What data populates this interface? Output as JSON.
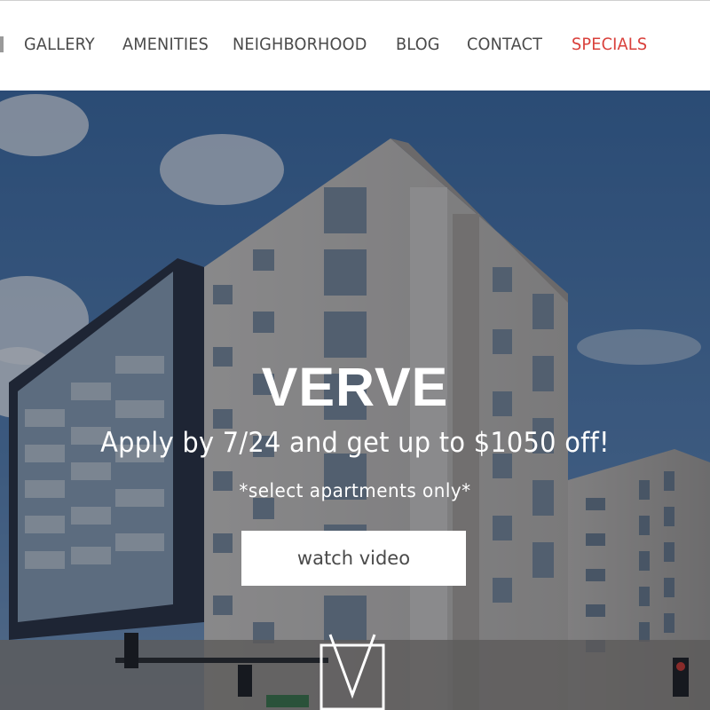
{
  "nav": {
    "items": [
      {
        "label": "GALLERY"
      },
      {
        "label": "AMENITIES"
      },
      {
        "label": "NEIGHBORHOOD"
      },
      {
        "label": "BLOG"
      },
      {
        "label": "CONTACT"
      },
      {
        "label": "SPECIALS"
      }
    ],
    "specials_color": "#d9403b",
    "text_color": "#4a4a4a"
  },
  "hero": {
    "title": "VERVE",
    "subtitle": "Apply by 7/24 and get up to $1050 off!",
    "note": "*select apartments only*",
    "button_label": "watch video",
    "background": "apartment-building-photo"
  },
  "logo": {
    "icon": "v-monogram-logo-icon"
  }
}
